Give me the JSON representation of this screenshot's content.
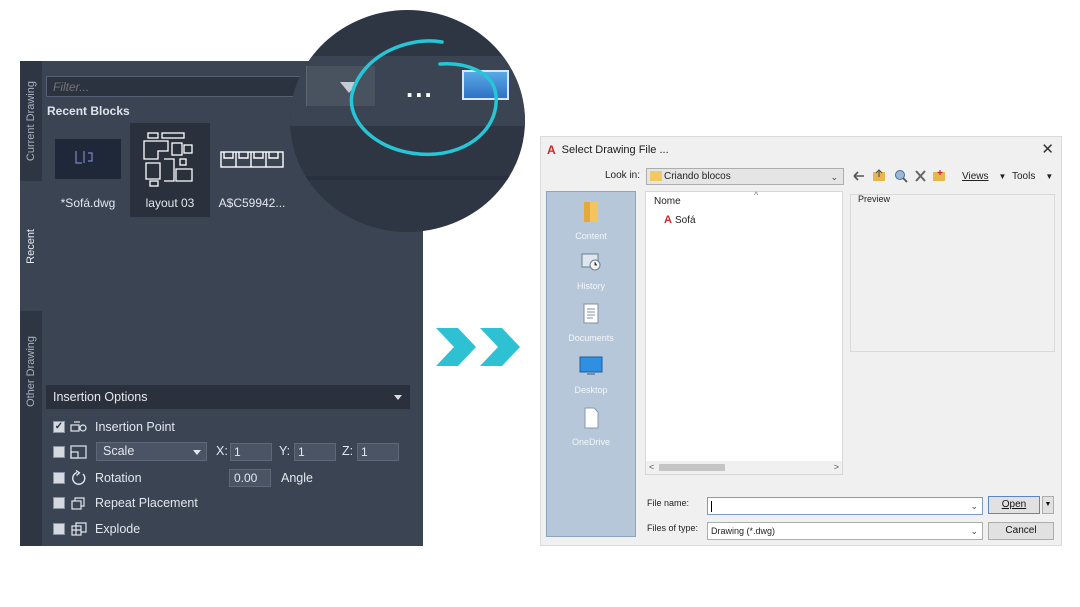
{
  "palette": {
    "tabs": {
      "current": "Current Drawing",
      "recent": "Recent",
      "other": "Other Drawing"
    },
    "filter_placeholder": "Filter...",
    "recent_title": "Recent Blocks",
    "blocks": [
      {
        "label": "*Sofá.dwg"
      },
      {
        "label": "layout 03"
      },
      {
        "label": "A$C59942..."
      }
    ],
    "insertion_options": {
      "title": "Insertion Options",
      "insertion_point": {
        "label": "Insertion Point",
        "checked": true
      },
      "scale": {
        "label": "Scale",
        "x_label": "X:",
        "x": "1",
        "y_label": "Y:",
        "y": "1",
        "z_label": "Z:",
        "z": "1"
      },
      "rotation": {
        "label": "Rotation",
        "value": "0.00",
        "unit_label": "Angle"
      },
      "repeat_placement": {
        "label": "Repeat Placement"
      },
      "explode": {
        "label": "Explode"
      }
    }
  },
  "zoom": {
    "more_label": "..."
  },
  "dialog": {
    "title": "Select Drawing File ...",
    "close": "✕",
    "look_in_label": "Look in:",
    "look_in_value": "Criando blocos",
    "toolbar": {
      "views": "Views",
      "tools": "Tools"
    },
    "places": [
      {
        "label": "Content"
      },
      {
        "label": "History"
      },
      {
        "label": "Documents"
      },
      {
        "label": "Desktop"
      },
      {
        "label": "OneDrive"
      }
    ],
    "list_header": "Nome",
    "files": [
      {
        "name": "Sofá"
      }
    ],
    "preview_label": "Preview",
    "file_name_label": "File name:",
    "file_name_value": "",
    "files_of_type_label": "Files of type:",
    "files_of_type_value": "Drawing (*.dwg)",
    "open_label": "Open",
    "cancel_label": "Cancel"
  }
}
